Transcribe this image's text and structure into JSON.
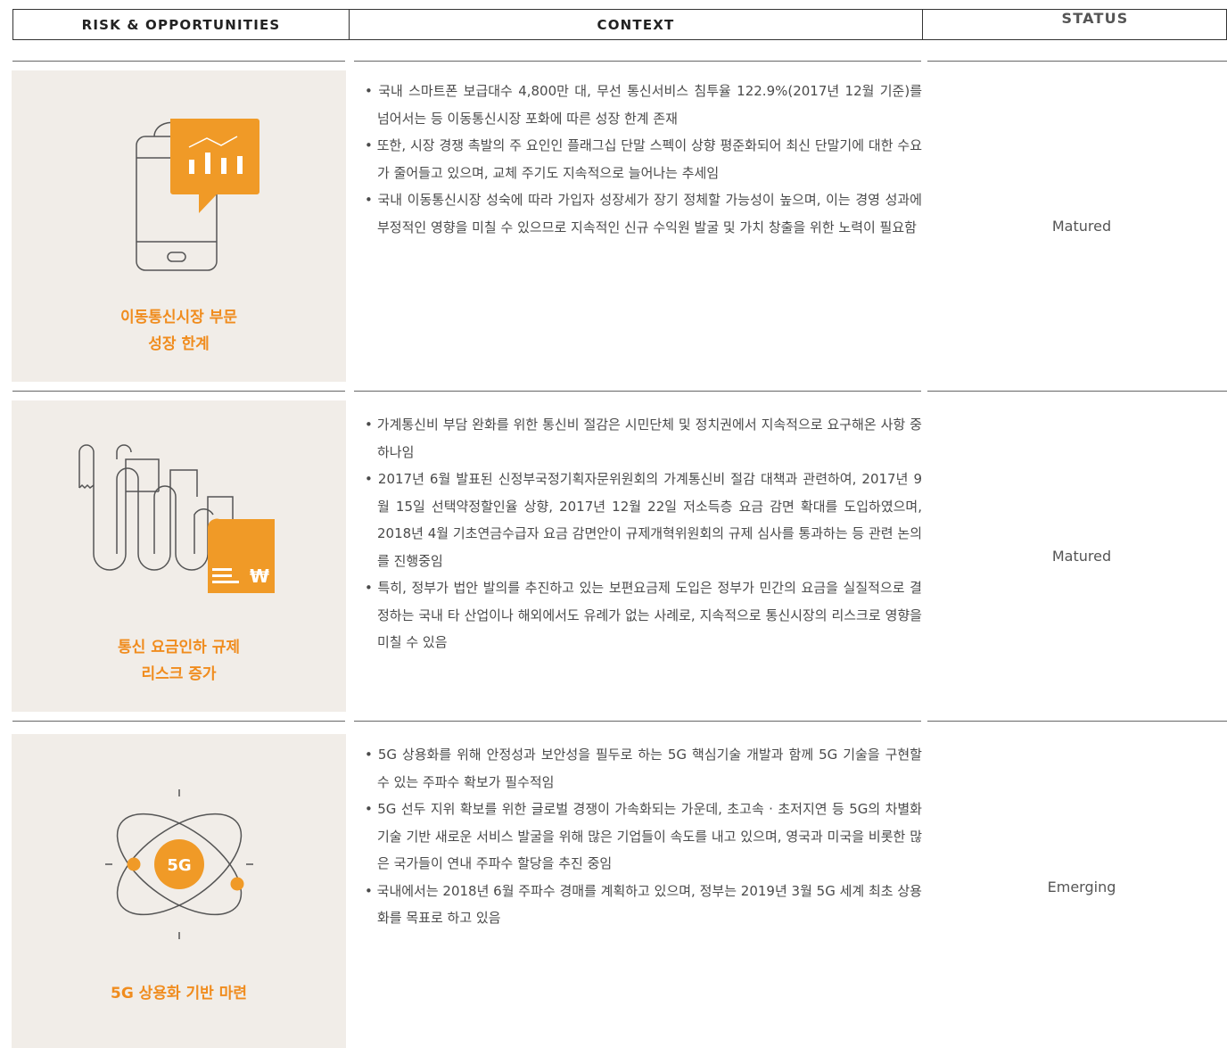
{
  "header": {
    "risk_label": "RISK & OPPORTUNITIES",
    "context_label": "CONTEXT",
    "status_label": "STATUS"
  },
  "rows": [
    {
      "title": "이동통신시장 부문\n성장 한계",
      "icon": "smartphone-chart-icon",
      "bullets": [
        "국내 스마트폰 보급대수 4,800만 대, 무선 통신서비스 침투율 122.9%(2017년 12월 기준)를 넘어서는 등 이동통신시장 포화에 따른 성장 한계 존재",
        "또한, 시장 경쟁 촉발의 주 요인인 플래그십 단말 스펙이 상향 평준화되어 최신 단말기에 대한 수요가 줄어들고 있으며, 교체 주기도 지속적으로 늘어나는 추세임",
        "국내 이동통신시장 성숙에 따라 가입자 성장세가 장기 정체할 가능성이 높으며, 이는 경영 성과에 부정적인 영향을 미칠 수 있으므로 지속적인 신규 수익원 발굴 및 가치 창출을 위한 노력이 필요함"
      ],
      "status": "Matured"
    },
    {
      "title": "통신 요금인하 규제\n리스크 증가",
      "icon": "receipt-won-icon",
      "icon_text": "₩",
      "bullets": [
        "가계통신비 부담 완화를 위한 통신비 절감은 시민단체 및 정치권에서 지속적으로 요구해온 사항 중 하나임",
        " 2017년 6월 발표된 신정부국정기획자문위원회의 가계통신비 절감 대책과 관련하여, 2017년 9월 15일 선택약정할인율 상향, 2017년 12월 22일 저소득층 요금 감면 확대를 도입하였으며, 2018년 4월 기초연금수급자 요금 감면안이 규제개혁위원회의 규제 심사를 통과하는 등 관련 논의를 진행중임",
        "특히, 정부가 법안 발의를 추진하고 있는 보편요금제 도입은 정부가 민간의 요금을 실질적으로 결정하는 국내 타 산업이나 해외에서도 유례가 없는 사례로, 지속적으로 통신시장의 리스크로 영향을 미칠 수 있음"
      ],
      "status": "Matured"
    },
    {
      "title": "5G 상용화 기반 마련",
      "icon": "5g-atom-icon",
      "icon_text": "5G",
      "bullets": [
        "5G 상용화를 위해 안정성과 보안성을 필두로 하는 5G 핵심기술 개발과 함께 5G 기술을 구현할 수 있는 주파수 확보가 필수적임",
        "5G 선두 지위 확보를 위한 글로벌 경쟁이 가속화되는 가운데, 초고속 · 초저지연 등 5G의 차별화 기술 기반 새로운 서비스 발굴을 위해 많은 기업들이 속도를 내고 있으며, 영국과 미국을 비롯한 많은 국가들이 연내 주파수 할당을 추진 중임",
        "국내에서는 2018년 6월 주파수 경매를 계획하고 있으며, 정부는 2019년 3월 5G 세계 최초 상용화를 목표로 하고 있음"
      ],
      "status": "Emerging"
    }
  ]
}
